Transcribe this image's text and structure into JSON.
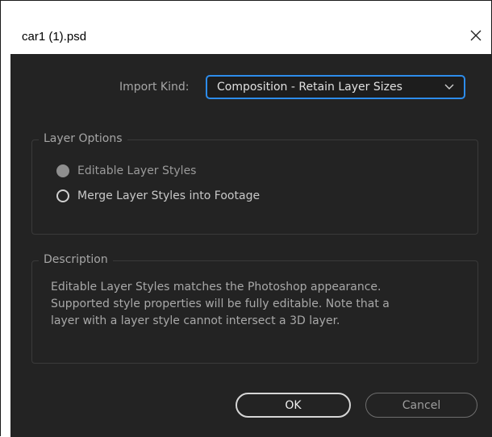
{
  "window": {
    "title": "car1 (1).psd"
  },
  "import": {
    "label": "Import Kind:",
    "selected": "Composition - Retain Layer Sizes"
  },
  "layer_options": {
    "legend": "Layer Options",
    "options": [
      {
        "label": "Editable Layer Styles",
        "state": "selected-disabled"
      },
      {
        "label": "Merge Layer Styles into Footage",
        "state": "unselected"
      }
    ]
  },
  "description": {
    "legend": "Description",
    "lines": [
      "Editable Layer Styles matches the Photoshop appearance.",
      "Supported style properties will be fully editable. Note that a",
      "layer with a layer style cannot intersect a 3D layer."
    ]
  },
  "buttons": {
    "ok": "OK",
    "cancel": "Cancel"
  },
  "icons": {
    "close": "close-icon",
    "dropdown": "chevron-down-icon"
  },
  "colors": {
    "accent": "#2d8ceb",
    "panel": "#232323"
  }
}
